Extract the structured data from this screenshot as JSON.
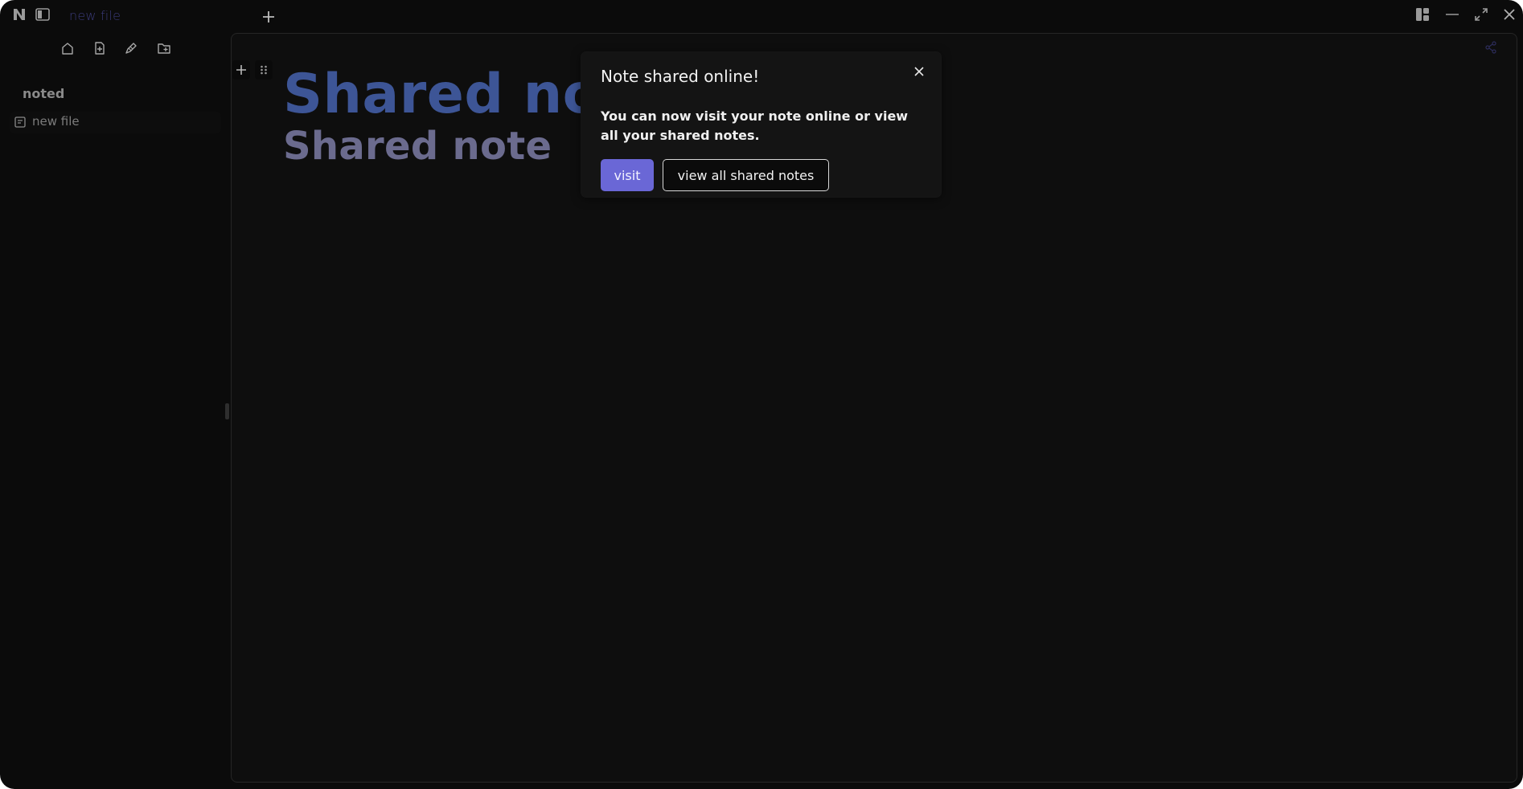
{
  "titlebar": {
    "app_logo": "N",
    "tab_label": "new file",
    "icons": {
      "sidebar_toggle": "sidebar-toggle-icon",
      "new_tab": "plus-icon",
      "layout": "layout-icon",
      "minimize": "minimize-icon",
      "maximize": "maximize-icon",
      "close": "close-icon"
    }
  },
  "sidebar": {
    "toolbar": [
      "home-icon",
      "new-file-icon",
      "new-canvas-icon",
      "new-folder-icon"
    ],
    "workspace_title": "noted",
    "files": [
      {
        "label": "new file",
        "icon": "note-icon"
      }
    ]
  },
  "editor": {
    "heading1": "Shared note",
    "heading2": "Shared note",
    "colors": {
      "h1": "#3d5596",
      "h2": "#6b6b8e"
    }
  },
  "popup": {
    "title": "Note shared online!",
    "body": "You can now visit your note online or view all your shared notes.",
    "visit_label": "visit",
    "view_all_label": "view all shared notes",
    "accent": "#6a67d6"
  }
}
